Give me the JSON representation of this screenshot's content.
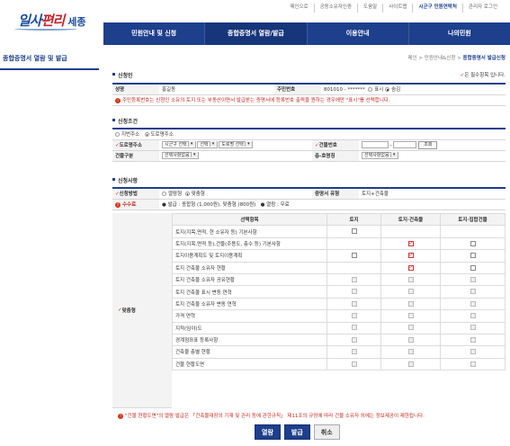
{
  "util_links": [
    "메인으로",
    "공동소유자인증",
    "도움말",
    "사이트맵",
    "시군구 민원연락처",
    "관리자 로그인"
  ],
  "util_highlight_index": 4,
  "logo": {
    "text_a": "일사",
    "text_b": "편리",
    "sub": "세종"
  },
  "gnb": [
    "민원안내 및 신청",
    "종합증명서 열람/발급",
    "이용안내",
    "나의민원"
  ],
  "gnb_active": 1,
  "lnb_title": "종합증명서 열람 및 발급",
  "breadcrumb": {
    "prefix": "메인 > 민원안내&신청 > ",
    "current": "종합증명서 발급신청"
  },
  "required_note": {
    "mark": "✓",
    "text": "은 필수항목 입니다."
  },
  "applicant": {
    "section": "신청인",
    "name_label": "성명",
    "name_value": "홍길동",
    "rrn_label": "주민번호",
    "rrn_value": "801010 - *******",
    "opt_show": "표시",
    "opt_hide": "숨김",
    "warning": "주민등록번호는 신청인 소유의 토지 또는 부동산이면서 발급받는 증명서에 등록번호 출력을 원하는 경우에만 \"표시\"를 선택합니다."
  },
  "condition": {
    "section": "신청조건",
    "addr_type_1": "지번주소",
    "addr_type_2": "도로명주소",
    "road_label": "도로명주소",
    "sel_1": "시군구 선택",
    "sel_2": "선택",
    "sel_3": "도로명 선택",
    "bldg_no_label": "건물번호",
    "search_btn": "조회",
    "bldg_kind_label": "건물구분",
    "bldg_kind_value": "선택사항없음",
    "floor_label": "층-호명칭",
    "floor_value": "선택사항없음"
  },
  "details": {
    "section": "신청사항",
    "method_label": "신청방법",
    "method_1": "열람형",
    "method_2": "맞춤형",
    "cert_type_label": "증명서 유형",
    "cert_type_value": "토지+건축물",
    "fee_label": "수수료",
    "fee_1": "발급 : 종합형 (1,000원), 맞춤형 (800원)",
    "fee_2": "열람 : 무료",
    "custom_label": "맞춤형",
    "columns": [
      "선택항목",
      "토지",
      "토지·건축물",
      "토지·집합건물"
    ],
    "rows": [
      {
        "label": "토지(지목,면적, 현 소유자 등) 기본사항",
        "c": [
          "empty",
          "none",
          "none"
        ]
      },
      {
        "label": "토지(지목,면적 등),건물(주용도, 층수 등) 기본사항",
        "c": [
          "none",
          "on",
          "empty"
        ]
      },
      {
        "label": "토지이용계획도 및 토지이용계획",
        "c": [
          "empty",
          "on",
          "empty"
        ]
      },
      {
        "label": "토지 건축물 소유자 현황",
        "c": [
          "none",
          "on",
          "empty"
        ]
      },
      {
        "label": "토지 건축물 소유자 공유현황",
        "c": [
          "dis",
          "dis",
          "dis"
        ]
      },
      {
        "label": "토지 건축물 표시 변동 연혁",
        "c": [
          "dis",
          "dis",
          "dis"
        ]
      },
      {
        "label": "토지 건축물 소유자 변동 연혁",
        "c": [
          "dis",
          "dis",
          "dis"
        ]
      },
      {
        "label": "가격 연혁",
        "c": [
          "dis",
          "dis",
          "dis"
        ]
      },
      {
        "label": "지적(임야)도",
        "c": [
          "dis",
          "dis",
          "dis"
        ]
      },
      {
        "label": "경계점좌표 등록사항",
        "c": [
          "dis",
          "dis",
          "dis"
        ]
      },
      {
        "label": "건축물 층별 현황",
        "c": [
          "dis",
          "dis",
          "dis"
        ]
      },
      {
        "label": "건물 현황도면",
        "c": [
          "dis",
          "dis",
          "dis"
        ]
      }
    ],
    "footnote": "\"건물 현황도면\"의 열람·발급은 「건축물대장의 기재 및 관리 등에 관한규칙」 제11조의 규정에 따라 건물 소유자 외에는 정보제공이 제한됩니다."
  },
  "buttons": {
    "view": "열람",
    "issue": "발급",
    "cancel": "취소"
  }
}
